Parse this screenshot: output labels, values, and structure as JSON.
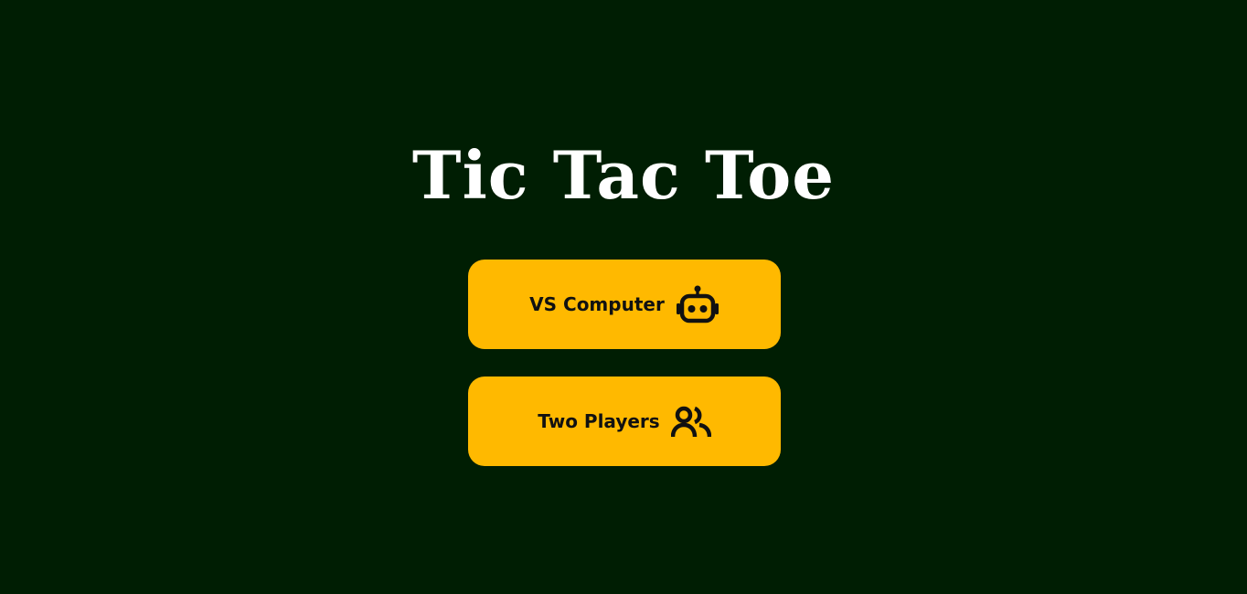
{
  "title": "Tic Tac Toe",
  "menu": {
    "vs_computer": {
      "label": "VS Computer",
      "icon": "robot-icon"
    },
    "two_players": {
      "label": "Two Players",
      "icon": "users-icon"
    }
  },
  "colors": {
    "background": "#001e03",
    "button": "#ffb900",
    "button_text": "#111111",
    "title_text": "#ffffff"
  }
}
